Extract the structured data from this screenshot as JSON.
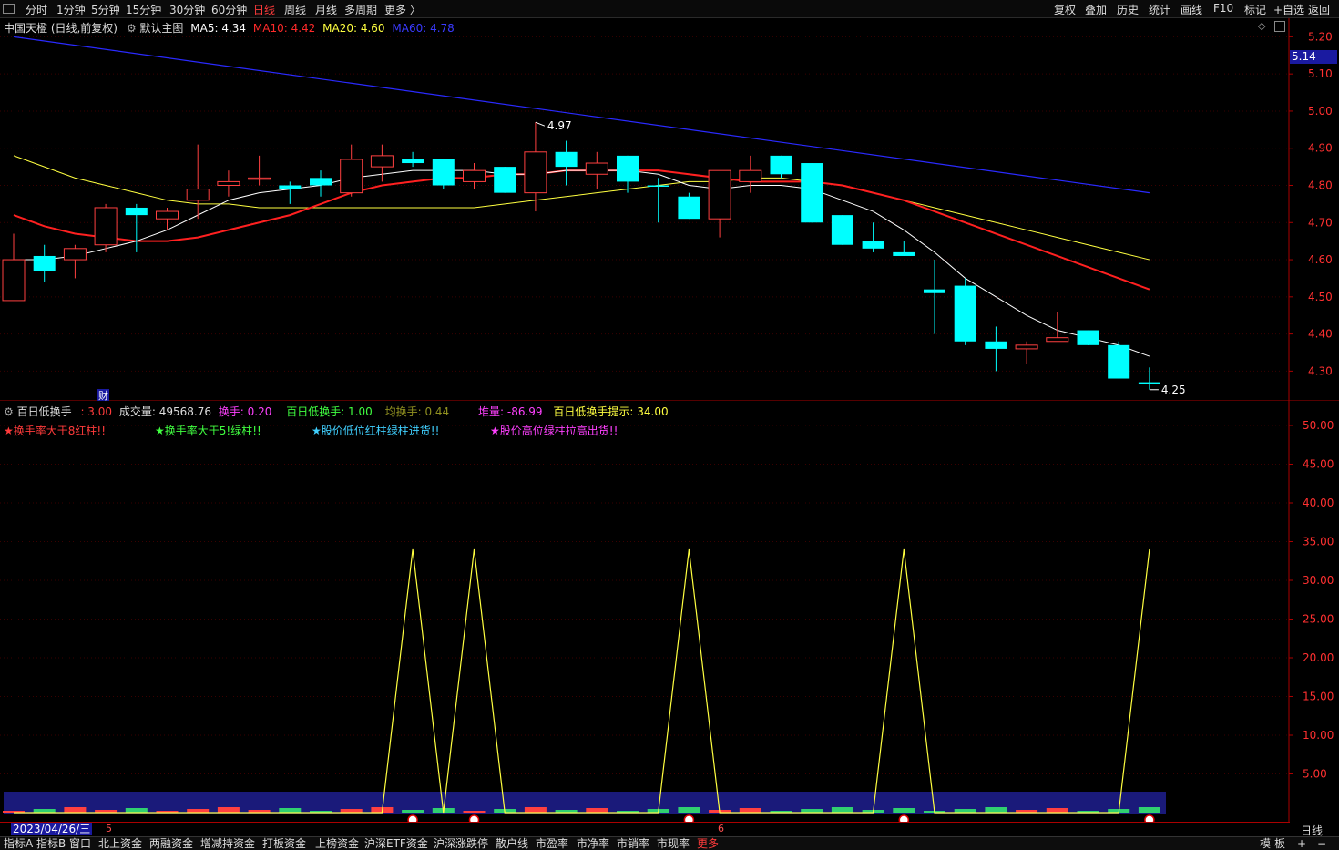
{
  "toolbar": {
    "periods": [
      "分时",
      "1分钟",
      "5分钟",
      "15分钟",
      "30分钟",
      "60分钟",
      "日线",
      "周线",
      "月线",
      "多周期",
      "更多 〉"
    ],
    "active_period": "日线",
    "right_buttons": [
      "复权",
      "叠加",
      "历史",
      "统计",
      "画线",
      "F10",
      "标记",
      "+自选",
      "返回"
    ]
  },
  "main_info": {
    "stock": "中国天楹 (日线,前复权)",
    "template": "默认主图",
    "ma5": "MA5: 4.34",
    "ma10": "MA10: 4.42",
    "ma20": "MA20: 4.60",
    "ma60": "MA60: 4.78",
    "colors": {
      "ma5": "#ffffff",
      "ma10": "#ff2020",
      "ma20": "#ffff40",
      "ma60": "#3030ff"
    }
  },
  "price_axis": {
    "ticks": [
      "5.20",
      "5.10",
      "5.00",
      "4.90",
      "4.80",
      "4.70",
      "4.60",
      "4.50",
      "4.40",
      "4.30"
    ],
    "current_price": "5.14"
  },
  "annotations": {
    "high": "4.97",
    "low": "4.25",
    "cai": "财"
  },
  "sub_info": {
    "name": "百日低换手",
    "value": ": 3.00",
    "volume": "成交量: 49568.76",
    "turnover": "换手: 0.20",
    "low_turnover": "百日低换手: 1.00",
    "avg_turnover": "均换手: 0.44",
    "pile": "堆量: -86.99",
    "hint": "百日低换手提示: 34.00"
  },
  "sub_notes": [
    "★换手率大于8红柱!!",
    "★换手率大于5!绿柱!!",
    "★股价低位红柱绿柱进货!!",
    "★股价高位绿柱拉高出货!!"
  ],
  "sub_axis": {
    "ticks": [
      "50.00",
      "45.00",
      "40.00",
      "35.00",
      "30.00",
      "25.00",
      "20.00",
      "15.00",
      "10.00",
      "5.00"
    ]
  },
  "date_bar": {
    "date": "2023/04/26/三",
    "month5": "5",
    "month6": "6",
    "period": "日线"
  },
  "bottom_tabs": [
    "指标A",
    "指标B",
    "窗口",
    "北上资金",
    "两融资金",
    "增减持资金",
    "打板资金",
    "上榜资金",
    "沪深ETF资金",
    "沪深涨跌停",
    "散户线",
    "市盈率",
    "市净率",
    "市销率",
    "市现率",
    "更多"
  ],
  "bottom_right": [
    "模",
    "板",
    "+",
    "−"
  ],
  "chart_data": {
    "type": "candlestick",
    "dates_note": "",
    "candles": [
      {
        "o": 4.49,
        "h": 4.67,
        "l": 4.55,
        "c": 4.6,
        "up": true
      },
      {
        "o": 4.61,
        "h": 4.64,
        "l": 4.54,
        "c": 4.57,
        "up": false
      },
      {
        "o": 4.6,
        "h": 4.64,
        "l": 4.55,
        "c": 4.63,
        "up": true
      },
      {
        "o": 4.64,
        "h": 4.75,
        "l": 4.62,
        "c": 4.74,
        "up": true
      },
      {
        "o": 4.74,
        "h": 4.75,
        "l": 4.62,
        "c": 4.72,
        "up": false
      },
      {
        "o": 4.71,
        "h": 4.74,
        "l": 4.68,
        "c": 4.73,
        "up": true
      },
      {
        "o": 4.76,
        "h": 4.91,
        "l": 4.71,
        "c": 4.79,
        "up": true
      },
      {
        "o": 4.8,
        "h": 4.84,
        "l": 4.77,
        "c": 4.81,
        "up": true
      },
      {
        "o": 4.82,
        "h": 4.88,
        "l": 4.8,
        "c": 4.82,
        "up": true
      },
      {
        "o": 4.8,
        "h": 4.81,
        "l": 4.75,
        "c": 4.79,
        "up": false
      },
      {
        "o": 4.82,
        "h": 4.84,
        "l": 4.77,
        "c": 4.8,
        "up": false
      },
      {
        "o": 4.78,
        "h": 4.91,
        "l": 4.77,
        "c": 4.87,
        "up": true
      },
      {
        "o": 4.85,
        "h": 4.91,
        "l": 4.81,
        "c": 4.88,
        "up": true
      },
      {
        "o": 4.87,
        "h": 4.89,
        "l": 4.85,
        "c": 4.86,
        "up": false
      },
      {
        "o": 4.87,
        "h": 4.87,
        "l": 4.79,
        "c": 4.8,
        "up": false
      },
      {
        "o": 4.81,
        "h": 4.86,
        "l": 4.79,
        "c": 4.84,
        "up": true
      },
      {
        "o": 4.85,
        "h": 4.85,
        "l": 4.78,
        "c": 4.78,
        "up": false
      },
      {
        "o": 4.78,
        "h": 4.97,
        "l": 4.73,
        "c": 4.89,
        "up": true
      },
      {
        "o": 4.89,
        "h": 4.92,
        "l": 4.8,
        "c": 4.85,
        "up": false
      },
      {
        "o": 4.83,
        "h": 4.89,
        "l": 4.79,
        "c": 4.86,
        "up": true
      },
      {
        "o": 4.88,
        "h": 4.88,
        "l": 4.78,
        "c": 4.81,
        "up": false
      },
      {
        "o": 4.8,
        "h": 4.82,
        "l": 4.7,
        "c": 4.8,
        "up": false
      },
      {
        "o": 4.77,
        "h": 4.78,
        "l": 4.71,
        "c": 4.71,
        "up": false
      },
      {
        "o": 4.71,
        "h": 4.84,
        "l": 4.66,
        "c": 4.84,
        "up": true
      },
      {
        "o": 4.81,
        "h": 4.88,
        "l": 4.78,
        "c": 4.84,
        "up": true
      },
      {
        "o": 4.88,
        "h": 4.88,
        "l": 4.82,
        "c": 4.83,
        "up": false
      },
      {
        "o": 4.86,
        "h": 4.86,
        "l": 4.7,
        "c": 4.7,
        "up": false
      },
      {
        "o": 4.72,
        "h": 4.72,
        "l": 4.64,
        "c": 4.64,
        "up": false
      },
      {
        "o": 4.65,
        "h": 4.7,
        "l": 4.62,
        "c": 4.63,
        "up": false
      },
      {
        "o": 4.62,
        "h": 4.65,
        "l": 4.61,
        "c": 4.61,
        "up": false
      },
      {
        "o": 4.52,
        "h": 4.6,
        "l": 4.4,
        "c": 4.51,
        "up": false
      },
      {
        "o": 4.53,
        "h": 4.55,
        "l": 4.37,
        "c": 4.38,
        "up": false
      },
      {
        "o": 4.38,
        "h": 4.42,
        "l": 4.3,
        "c": 4.36,
        "up": false
      },
      {
        "o": 4.36,
        "h": 4.38,
        "l": 4.32,
        "c": 4.37,
        "up": true
      },
      {
        "o": 4.38,
        "h": 4.46,
        "l": 4.38,
        "c": 4.39,
        "up": true
      },
      {
        "o": 4.41,
        "h": 4.41,
        "l": 4.37,
        "c": 4.37,
        "up": false
      },
      {
        "o": 4.37,
        "h": 4.38,
        "l": 4.28,
        "c": 4.28,
        "up": false
      },
      {
        "o": 4.27,
        "h": 4.31,
        "l": 4.25,
        "c": 4.27,
        "up": false
      }
    ],
    "ma5": [
      4.6,
      4.6,
      4.61,
      4.63,
      4.65,
      4.68,
      4.72,
      4.76,
      4.78,
      4.79,
      4.8,
      4.82,
      4.83,
      4.84,
      4.84,
      4.84,
      4.83,
      4.83,
      4.84,
      4.84,
      4.84,
      4.83,
      4.8,
      4.79,
      4.8,
      4.8,
      4.79,
      4.76,
      4.73,
      4.68,
      4.62,
      4.55,
      4.5,
      4.45,
      4.41,
      4.39,
      4.37,
      4.34
    ],
    "ma10": [
      4.72,
      4.69,
      4.67,
      4.66,
      4.65,
      4.65,
      4.66,
      4.68,
      4.7,
      4.72,
      4.75,
      4.78,
      4.8,
      4.81,
      4.82,
      4.82,
      4.83,
      4.83,
      4.84,
      4.84,
      4.84,
      4.84,
      4.83,
      4.82,
      4.81,
      4.81,
      4.81,
      4.8,
      4.78,
      4.76,
      4.73,
      4.7,
      4.67,
      4.64,
      4.61,
      4.58,
      4.55,
      4.52,
      4.49,
      4.46,
      4.43,
      4.42
    ],
    "ma20": [
      4.88,
      4.85,
      4.82,
      4.8,
      4.78,
      4.76,
      4.75,
      4.75,
      4.74,
      4.74,
      4.74,
      4.74,
      4.74,
      4.74,
      4.74,
      4.74,
      4.75,
      4.76,
      4.77,
      4.78,
      4.79,
      4.8,
      4.81,
      4.81,
      4.82,
      4.82,
      4.81,
      4.8,
      4.78,
      4.76,
      4.74,
      4.72,
      4.7,
      4.68,
      4.66,
      4.64,
      4.62,
      4.6
    ],
    "ma60": {
      "start": 5.2,
      "end": 4.78
    },
    "sub_signal": [
      0,
      0,
      0,
      0,
      0,
      0,
      0,
      0,
      0,
      0,
      0,
      0,
      0,
      34,
      0,
      34,
      0,
      0,
      0,
      0,
      0,
      0,
      34,
      0,
      0,
      0,
      0,
      0,
      0,
      34,
      0,
      0,
      0,
      0,
      0,
      0,
      0,
      34
    ],
    "sub_ylim": [
      0,
      52
    ]
  }
}
